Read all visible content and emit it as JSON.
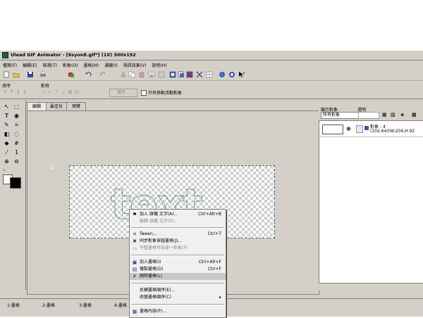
{
  "window": {
    "title": "Ulead GIF Animator - [6syon8.gif*] (1X) 500x192"
  },
  "menu": [
    "檔案(F)",
    "編輯(E)",
    "檢視(T)",
    "對象(O)",
    "畫格(M)",
    "濾鏡(I)",
    "視訊效果(V)",
    "說明(H)"
  ],
  "toolbar2": {
    "order_label": "排序",
    "align_label": "對齊",
    "property_button": "屬性...",
    "only_move_active_label": "只有移動活動對象"
  },
  "tabs": [
    "編輯",
    "最佳化",
    "預覽"
  ],
  "right_panel": {
    "show_objects_label": "顯示對象",
    "opacity_label": "透明",
    "filter_value": "所有對象",
    "object_name": "對象 - 4",
    "object_info": "(102,64)(W:204,H:92"
  },
  "frames": [
    "1:畫格",
    "2:畫格",
    "3:畫格",
    "4:畫格"
  ],
  "context_menu": [
    {
      "label": "加入 旗幟 文字(A)...",
      "shortcut": "Ctrl+Alt+B",
      "icon": "add-text-icon",
      "disabled": false
    },
    {
      "label": "編輯 旗幟 文字(D)...",
      "shortcut": "",
      "icon": "",
      "disabled": true
    },
    {
      "label": "Tween...",
      "shortcut": "Ctrl+T",
      "icon": "tween-icon",
      "disabled": false
    },
    {
      "label": "同步對象穿越畫格(J)...",
      "shortcut": "",
      "icon": "sync-icon",
      "disabled": false
    },
    {
      "label": "平整畫格作為單一對象(F)",
      "shortcut": "",
      "icon": "flatten-icon",
      "disabled": true
    },
    {
      "label": "加入畫格(I)",
      "shortcut": "Ctrl+Alt+F",
      "icon": "add-frame-icon",
      "disabled": false
    },
    {
      "label": "複製畫格(D)",
      "shortcut": "Ctrl+F",
      "icon": "duplicate-frame-icon",
      "disabled": false
    },
    {
      "label": "刪除畫格(L)",
      "shortcut": "",
      "icon": "delete-frame-icon",
      "disabled": false
    },
    {
      "label": "反轉畫格順序(E)...",
      "shortcut": "",
      "icon": "",
      "disabled": false
    },
    {
      "label": "改變畫格順序(C)",
      "shortcut": "▸",
      "icon": "",
      "disabled": false
    },
    {
      "label": "畫格內容(P)...",
      "shortcut": "",
      "icon": "frame-properties-icon",
      "disabled": false
    }
  ],
  "canvas": {
    "ghost_text": "text",
    "left_marker": "2",
    "right_marker": "F"
  }
}
